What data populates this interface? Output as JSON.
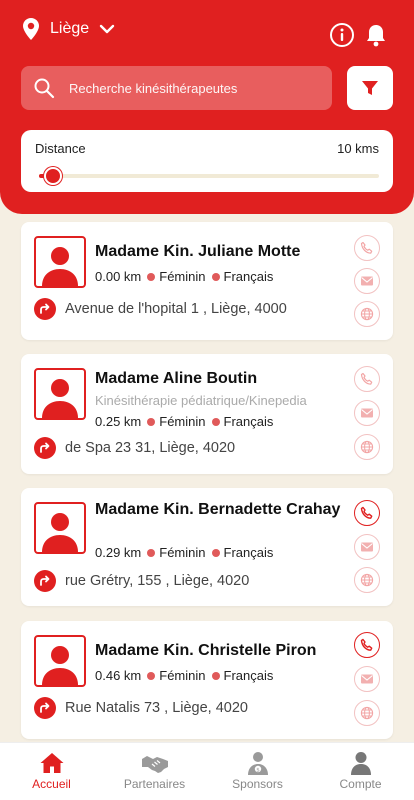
{
  "colors": {
    "primary": "#e02020",
    "background": "#f5efe3",
    "muted_red": "#f2c2c2"
  },
  "header": {
    "location": "Liège",
    "search_placeholder": "Recherche kinésithérapeutes",
    "distance_label": "Distance",
    "distance_value": "10 kms",
    "distance_slider_fraction": 0.04
  },
  "icons": {
    "location": "map-pin-icon",
    "dropdown": "chevron-down-icon",
    "info": "info-icon",
    "notifications": "bell-icon",
    "search": "search-icon",
    "filter": "filter-icon",
    "directions": "turn-right-arrow-icon",
    "phone": "phone-icon",
    "email": "envelope-icon",
    "website": "globe-icon"
  },
  "results": [
    {
      "name": "Madame Kin. Juliane Motte",
      "specialty": "",
      "distance": "0.00 km",
      "gender": "Féminin",
      "language": "Français",
      "address": "Avenue de l'hopital 1 , Liège, 4000",
      "phone_active": false
    },
    {
      "name": "Madame Aline Boutin",
      "specialty": "Kinésithérapie pédiatrique/Kinepedia",
      "distance": "0.25 km",
      "gender": "Féminin",
      "language": "Français",
      "address": "de Spa 23 31, Liège, 4020",
      "phone_active": false
    },
    {
      "name": "Madame Kin. Bernadette Crahay",
      "specialty": "",
      "distance": "0.29 km",
      "gender": "Féminin",
      "language": "Français",
      "address": "rue Grétry, 155 , Liège, 4020",
      "phone_active": true
    },
    {
      "name": "Madame Kin. Christelle Piron",
      "specialty": "",
      "distance": "0.46 km",
      "gender": "Féminin",
      "language": "Français",
      "address": "Rue Natalis 73 , Liège, 4020",
      "phone_active": true
    }
  ],
  "nav": [
    {
      "label": "Accueil",
      "icon": "home-icon",
      "active": true
    },
    {
      "label": "Partenaires",
      "icon": "handshake-icon",
      "active": false
    },
    {
      "label": "Sponsors",
      "icon": "sponsor-person-icon",
      "active": false
    },
    {
      "label": "Compte",
      "icon": "user-icon",
      "active": false
    }
  ]
}
